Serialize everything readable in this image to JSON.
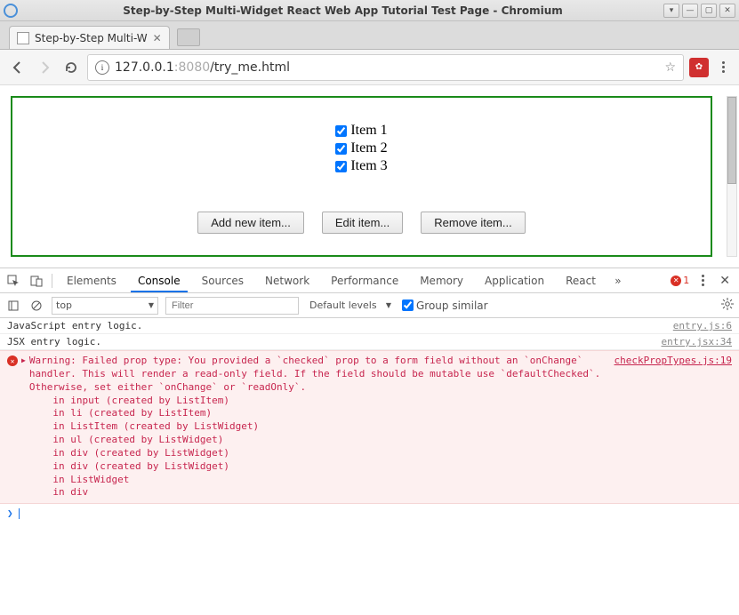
{
  "window": {
    "title": "Step-by-Step Multi-Widget React Web App Tutorial Test Page - Chromium"
  },
  "tab": {
    "title": "Step-by-Step Multi-W"
  },
  "addressbar": {
    "info_glyph": "i",
    "host_dim": "127.0.0.1",
    "port_dim": ":8080",
    "path": "/try_me.html"
  },
  "page": {
    "items": [
      "Item 1",
      "Item 2",
      "Item 3"
    ],
    "buttons": {
      "add": "Add new item...",
      "edit": "Edit item...",
      "remove": "Remove item..."
    }
  },
  "devtools": {
    "tabs": [
      "Elements",
      "Console",
      "Sources",
      "Network",
      "Performance",
      "Memory",
      "Application",
      "React"
    ],
    "active_tab": "Console",
    "error_count": "1",
    "filter": {
      "context": "top",
      "placeholder": "Filter",
      "levels": "Default levels",
      "group_similar": "Group similar"
    },
    "logs": [
      {
        "msg": "JavaScript entry logic.",
        "src": "entry.js:6"
      },
      {
        "msg": "JSX entry logic.",
        "src": "entry.jsx:34"
      }
    ],
    "error": {
      "src": "checkPropTypes.js:19",
      "text": "Warning: Failed prop type: You provided a `checked` prop to a form field without an `onChange` handler. This will render a read-only field. If the field should be mutable use `defaultChecked`. Otherwise, set either `onChange` or `readOnly`.\n    in input (created by ListItem)\n    in li (created by ListItem)\n    in ListItem (created by ListWidget)\n    in ul (created by ListWidget)\n    in div (created by ListWidget)\n    in div (created by ListWidget)\n    in ListWidget\n    in div"
    }
  }
}
